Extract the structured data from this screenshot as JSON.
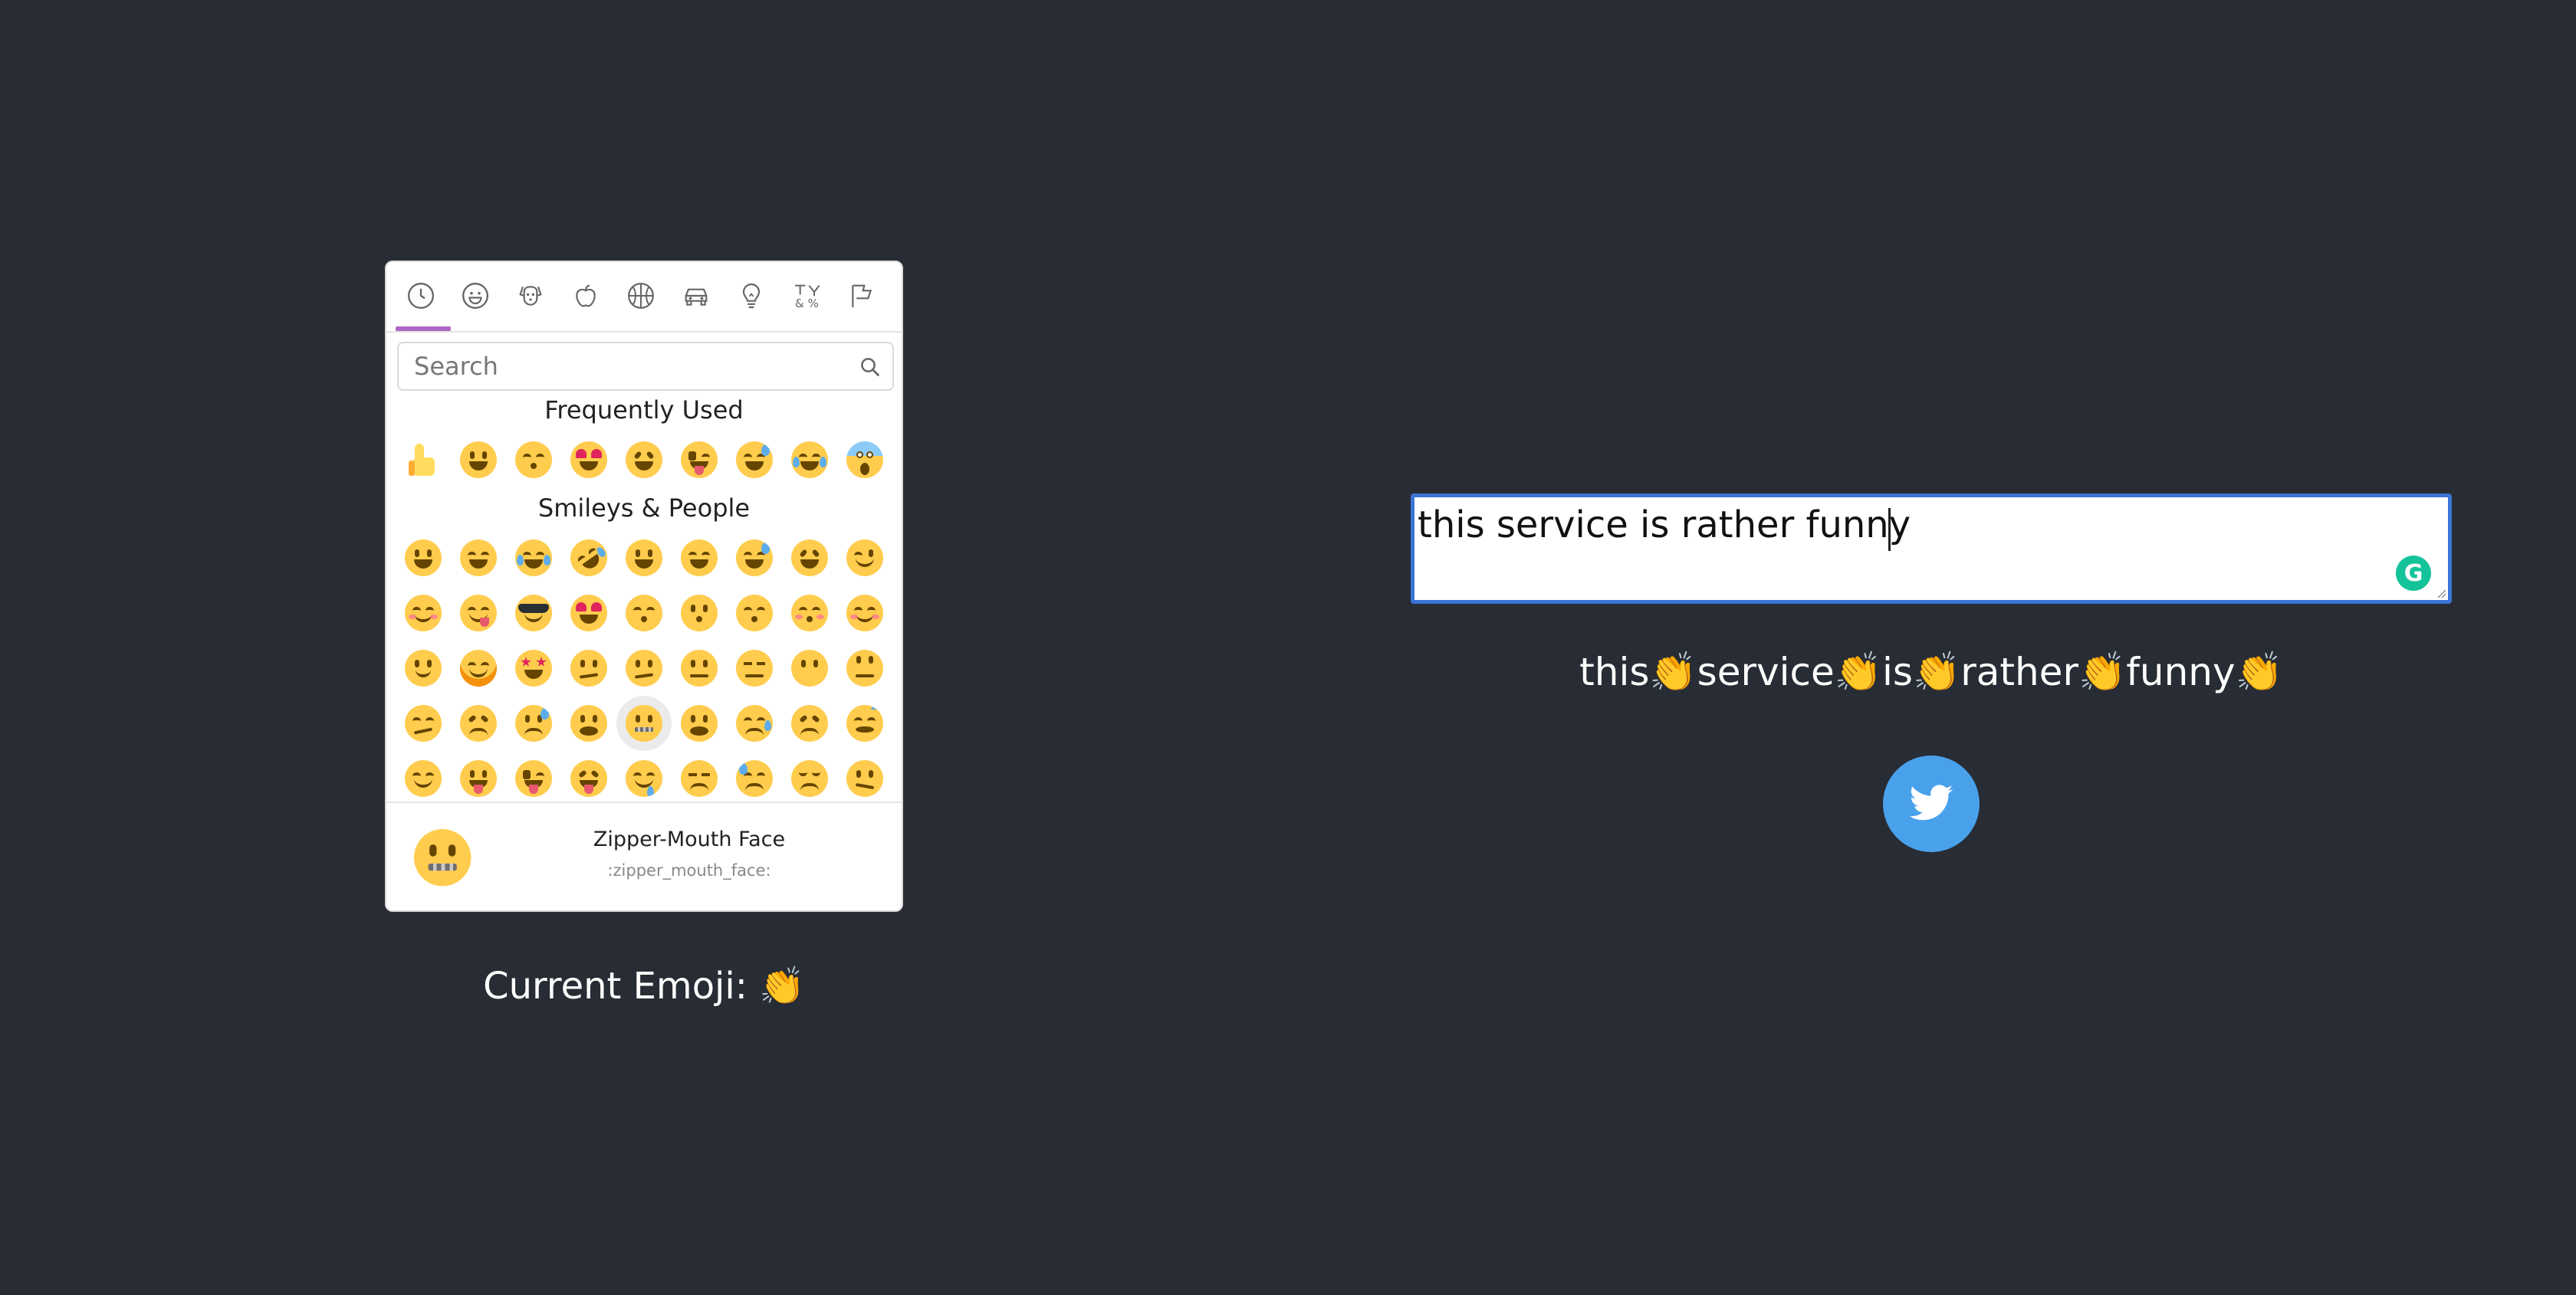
{
  "picker": {
    "categories": [
      {
        "name": "recent",
        "icon": "clock-icon"
      },
      {
        "name": "smileys",
        "icon": "smiley-icon"
      },
      {
        "name": "animals",
        "icon": "dog-icon"
      },
      {
        "name": "food",
        "icon": "apple-icon"
      },
      {
        "name": "activity",
        "icon": "basketball-icon"
      },
      {
        "name": "travel",
        "icon": "car-icon"
      },
      {
        "name": "objects",
        "icon": "lightbulb-icon"
      },
      {
        "name": "symbols",
        "icon": "symbols-icon"
      },
      {
        "name": "flags",
        "icon": "flag-icon"
      }
    ],
    "active_category": "recent",
    "accent_color": "#ae65c5",
    "search": {
      "placeholder": "Search",
      "value": ""
    },
    "sections": {
      "frequent_title": "Frequently Used",
      "smileys_title": "Smileys & People"
    },
    "frequently_used": [
      "thumbs_up",
      "grinning",
      "kissing_heart",
      "heart_eyes",
      "laughing",
      "stuck_out_tongue_winking_eye",
      "sweat_smile",
      "joy",
      "scream"
    ],
    "smileys_rows": [
      [
        "grinning",
        "grin",
        "joy",
        "rofl",
        "smiley",
        "smile",
        "sweat_smile",
        "laughing",
        "wink"
      ],
      [
        "blush",
        "yum",
        "sunglasses",
        "heart_eyes",
        "kissing_heart",
        "kissing",
        "kissing_smiling_eyes",
        "kissing_closed_eyes",
        "relaxed"
      ],
      [
        "slightly_smiling_face",
        "hugging_face",
        "star_struck",
        "thinking_face",
        "raised_eyebrow",
        "neutral_face",
        "expressionless",
        "no_mouth",
        "rolling_eyes"
      ],
      [
        "smirk",
        "persevere",
        "disappointed_relieved",
        "open_mouth",
        "zipper_mouth_face",
        "hushed",
        "sleepy",
        "tired_face",
        "sleeping"
      ],
      [
        "relieved",
        "stuck_out_tongue",
        "stuck_out_tongue_winking_eye",
        "stuck_out_tongue_closed_eyes",
        "drooling_face",
        "unamused",
        "sweat",
        "pensive",
        "confused"
      ]
    ],
    "hovered_emoji": "zipper_mouth_face",
    "preview": {
      "name": "Zipper-Mouth Face",
      "code": ":zipper_mouth_face:"
    }
  },
  "current_emoji": {
    "label": "Current Emoji: 👏"
  },
  "editor": {
    "value": "this service is rather funny ",
    "grammarly_color": "#15c39a",
    "border_color": "#3b73d6"
  },
  "output": {
    "text": "this👏service👏is👏rather👏funny👏"
  },
  "share": {
    "icon": "twitter-bird-icon",
    "color": "#4aa1eb"
  }
}
